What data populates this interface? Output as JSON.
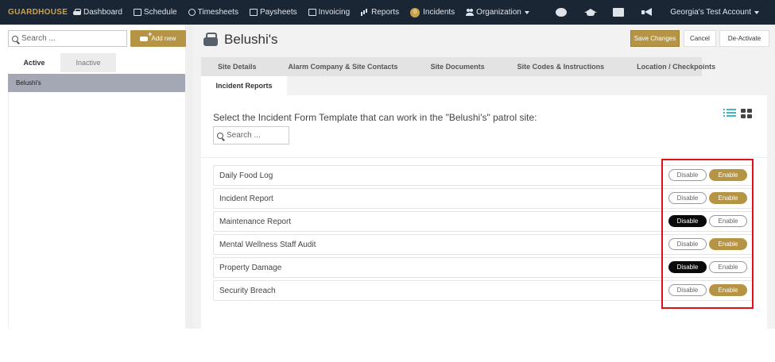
{
  "nav": {
    "brand": "GUARDHOUSE",
    "items": [
      {
        "label": "Dashboard",
        "icon": "car-icon"
      },
      {
        "label": "Schedule",
        "icon": "calendar-icon"
      },
      {
        "label": "Timesheets",
        "icon": "clock-icon"
      },
      {
        "label": "Paysheets",
        "icon": "money-icon"
      },
      {
        "label": "Invoicing",
        "icon": "invoice-icon"
      },
      {
        "label": "Reports",
        "icon": "bar-chart-icon"
      },
      {
        "label": "Incidents",
        "badge": "0",
        "icon": "badge-icon"
      },
      {
        "label": "Organization",
        "icon": "people-icon"
      }
    ],
    "account": "Georgia's Test Account"
  },
  "sidebar": {
    "search_placeholder": "Search ...",
    "add_new": "Add new",
    "tab_active": "Active",
    "tab_inactive": "Inactive",
    "sites": [
      "Belushi's"
    ]
  },
  "header": {
    "title": "Belushi's",
    "save": "Save Changes",
    "cancel": "Cancel",
    "deactivate": "De-Activate"
  },
  "tabs": [
    "Site Details",
    "Alarm Company & Site Contacts",
    "Site Documents",
    "Site Codes & Instructions",
    "Location / Checkpoints",
    "Incident Reports"
  ],
  "incident": {
    "prompt": "Select the Incident Form Template that can work in the \"Belushi's\" patrol site:",
    "search_placeholder": "Search ...",
    "disable_label": "Disable",
    "enable_label": "Enable",
    "templates": [
      {
        "name": "Daily Food Log",
        "enabled": true
      },
      {
        "name": "Incident Report",
        "enabled": true
      },
      {
        "name": "Maintenance Report",
        "enabled": false
      },
      {
        "name": "Mental Wellness Staff Audit",
        "enabled": true
      },
      {
        "name": "Property Damage",
        "enabled": false
      },
      {
        "name": "Security Breach",
        "enabled": true
      }
    ]
  },
  "colors": {
    "nav_bg": "#1b2634",
    "gold": "#b59445",
    "highlight": "#e0111a"
  }
}
